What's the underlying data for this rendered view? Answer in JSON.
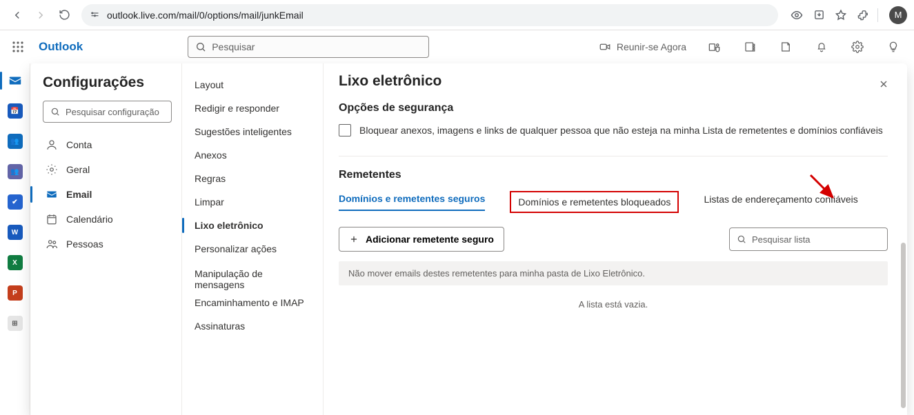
{
  "browser": {
    "url": "outlook.live.com/mail/0/options/mail/junkEmail",
    "avatar_letter": "M"
  },
  "outlook_bar": {
    "brand": "Outlook",
    "search_placeholder": "Pesquisar",
    "meet_label": "Reunir-se Agora"
  },
  "apprail": [
    {
      "name": "mail-icon",
      "color": "#0f6cbd"
    },
    {
      "name": "calendar-icon",
      "color": "#185abd",
      "label": "📅"
    },
    {
      "name": "people-icon",
      "color": "#0f6cbd",
      "label": "👥"
    },
    {
      "name": "groups-icon",
      "color": "#0f6cbd",
      "label": "👥"
    },
    {
      "name": "todo-icon",
      "color": "#2564cf",
      "label": "✔"
    },
    {
      "name": "word-icon",
      "color": "#185abd",
      "label": "W"
    },
    {
      "name": "excel-icon",
      "color": "#107c41",
      "label": "X"
    },
    {
      "name": "powerpoint-icon",
      "color": "#c43e1c",
      "label": "P"
    },
    {
      "name": "more-apps-icon",
      "color": "#8a8886",
      "label": "⊞"
    }
  ],
  "settings": {
    "title": "Configurações",
    "search_placeholder": "Pesquisar configuração",
    "categories": [
      {
        "id": "conta",
        "label": "Conta"
      },
      {
        "id": "geral",
        "label": "Geral"
      },
      {
        "id": "email",
        "label": "Email"
      },
      {
        "id": "calendario",
        "label": "Calendário"
      },
      {
        "id": "pessoas",
        "label": "Pessoas"
      }
    ],
    "active_category": "email",
    "email_options": [
      "Layout",
      "Redigir e responder",
      "Sugestões inteligentes",
      "Anexos",
      "Regras",
      "Limpar",
      "Lixo eletrônico",
      "Personalizar ações",
      "Manipulação de mensagens",
      "Encaminhamento e IMAP",
      "Assinaturas"
    ],
    "active_option": "Lixo eletrônico"
  },
  "junk": {
    "title": "Lixo eletrônico",
    "security_title": "Opções de segurança",
    "block_checkbox_label": "Bloquear anexos, imagens e links de qualquer pessoa que não esteja na minha Lista de remetentes e domínios confiáveis",
    "senders_title": "Remetentes",
    "tabs": [
      "Domínios e remetentes seguros",
      "Domínios e remetentes bloqueados",
      "Listas de endereçamento confiáveis"
    ],
    "active_tab": 0,
    "add_button": "Adicionar remetente seguro",
    "search_list_placeholder": "Pesquisar lista",
    "hint_stripe": "Não mover emails destes remetentes para minha pasta de Lixo Eletrônico.",
    "empty_text": "A lista está vazia."
  }
}
